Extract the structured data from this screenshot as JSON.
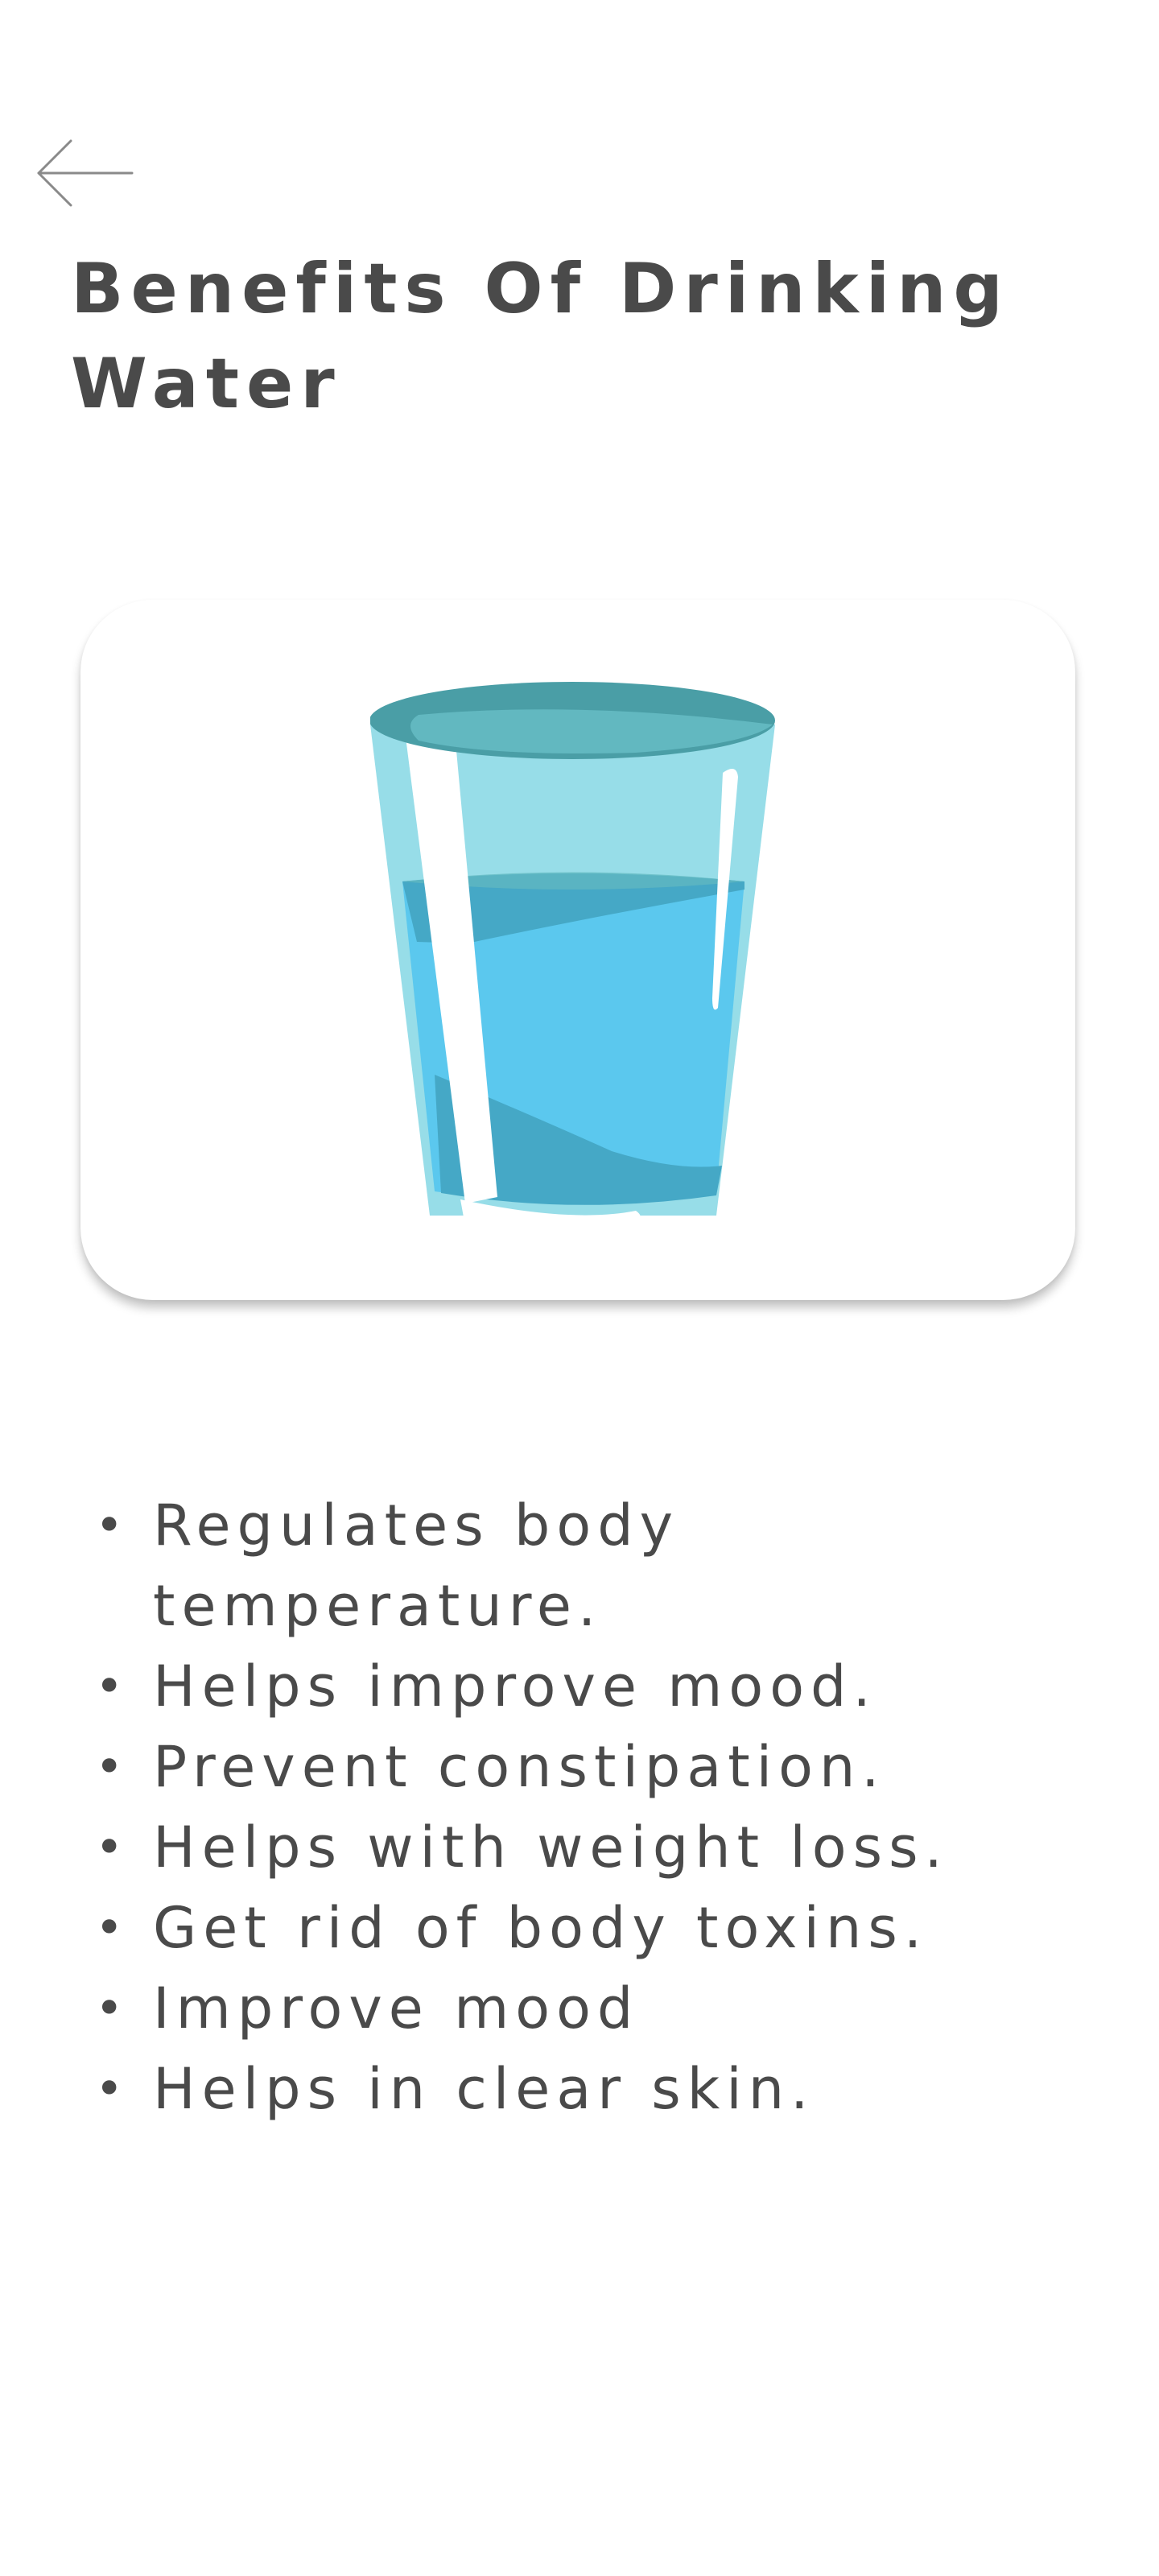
{
  "header": {
    "back_icon": "arrow-left-icon",
    "title": "Benefits Of Drinking Water"
  },
  "image_card": {
    "icon": "water-glass-illustration",
    "colors": {
      "rim": "#4a9ea6",
      "rim_inner": "#62b8c0",
      "glass_light": "#97dde8",
      "water": "#5bc8ee",
      "water_dark": "#45a8c6",
      "highlight": "#ffffff"
    }
  },
  "benefits": [
    {
      "text": "Regulates body temperature."
    },
    {
      "text": "Helps improve mood."
    },
    {
      "text": "Prevent constipation."
    },
    {
      "text": "Helps with weight loss."
    },
    {
      "text": "Get rid of body toxins."
    },
    {
      "text": "Improve mood"
    },
    {
      "text": "Helps in clear skin."
    }
  ],
  "colors": {
    "background": "#ffffff",
    "text": "#4a4a4a",
    "icon": "#8a8a8a"
  }
}
